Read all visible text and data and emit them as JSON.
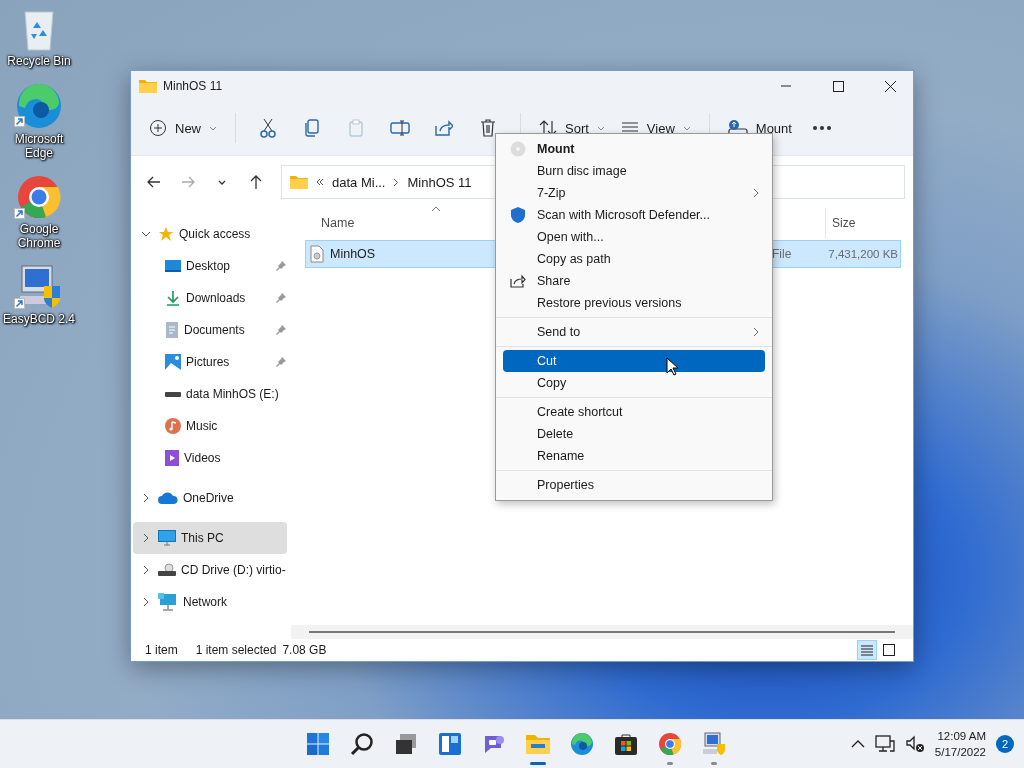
{
  "desktop_icons": [
    {
      "kind": "recycle",
      "label": "Recycle Bin",
      "shortcut": false
    },
    {
      "kind": "edge",
      "label": "Microsoft Edge",
      "shortcut": true
    },
    {
      "kind": "chrome",
      "label": "Google Chrome",
      "shortcut": true
    },
    {
      "kind": "easybcd",
      "label": "EasyBCD 2.4",
      "shortcut": true
    }
  ],
  "window": {
    "title": "MinhOS 11",
    "toolbar": [
      {
        "kind": "new",
        "label": "New",
        "disabled": false
      },
      {
        "kind": "separator"
      },
      {
        "kind": "cut",
        "disabled": false
      },
      {
        "kind": "copy",
        "disabled": false
      },
      {
        "kind": "paste",
        "disabled": true
      },
      {
        "kind": "rename",
        "disabled": false
      },
      {
        "kind": "share",
        "disabled": false
      },
      {
        "kind": "delete",
        "disabled": false
      },
      {
        "kind": "separator"
      },
      {
        "kind": "sort",
        "label": "Sort",
        "disabled": false
      },
      {
        "kind": "view",
        "label": "View",
        "disabled": false
      },
      {
        "kind": "separator"
      },
      {
        "kind": "mount",
        "label": "Mount",
        "disabled": false
      },
      {
        "kind": "more",
        "disabled": false
      }
    ],
    "nav": [
      {
        "kind": "back",
        "disabled": false
      },
      {
        "kind": "forward",
        "disabled": true
      },
      {
        "kind": "recent",
        "disabled": false
      },
      {
        "kind": "up",
        "disabled": false
      }
    ],
    "address": {
      "path": [
        "data Mi...",
        "MinhOS 11"
      ]
    },
    "sidebar": {
      "items": [
        {
          "kind": "star",
          "label": "Quick access",
          "expanded": true,
          "selected": false,
          "children": [
            {
              "kind": "desktop",
              "label": "Desktop",
              "pinned": true
            },
            {
              "kind": "download",
              "label": "Downloads",
              "pinned": true
            },
            {
              "kind": "documents",
              "label": "Documents",
              "pinned": true
            },
            {
              "kind": "pictures",
              "label": "Pictures",
              "pinned": true
            },
            {
              "kind": "drive",
              "label": "data MinhOS (E:)",
              "pinned": false
            },
            {
              "kind": "music",
              "label": "Music",
              "pinned": false
            },
            {
              "kind": "videos",
              "label": "Videos",
              "pinned": false
            }
          ]
        },
        {
          "kind": "cloud",
          "label": "OneDrive",
          "expanded": false,
          "selected": false
        },
        {
          "kind": "pc",
          "label": "This PC",
          "expanded": false,
          "selected": true
        },
        {
          "kind": "cd",
          "label": "CD Drive (D:) virtio-",
          "expanded": false,
          "selected": false
        },
        {
          "kind": "network",
          "label": "Network",
          "expanded": false,
          "selected": false
        }
      ]
    },
    "table": {
      "columns": [
        "Name",
        "Size"
      ],
      "rows": [
        {
          "name": "MinhOS",
          "type": "File",
          "size": "7,431,200 KB",
          "selected": true
        }
      ]
    },
    "status_bar": {
      "count": "1 item",
      "selection": "1 item selected",
      "size": "7.08 GB",
      "views": [
        {
          "kind": "details",
          "selected": true
        },
        {
          "kind": "tiles",
          "selected": false
        }
      ]
    }
  },
  "context_menu": {
    "items": [
      {
        "kind": "disc",
        "label": "Mount",
        "bold": true,
        "submenu": false,
        "selected": false
      },
      {
        "kind": "item",
        "label": "Burn disc image",
        "bold": false,
        "submenu": false,
        "selected": false
      },
      {
        "kind": "item",
        "label": "7-Zip",
        "bold": false,
        "submenu": true,
        "selected": false
      },
      {
        "kind": "shield",
        "label": "Scan with Microsoft Defender...",
        "bold": false,
        "submenu": false,
        "selected": false
      },
      {
        "kind": "item",
        "label": "Open with...",
        "bold": false,
        "submenu": false,
        "selected": false
      },
      {
        "kind": "item",
        "label": "Copy as path",
        "bold": false,
        "submenu": false,
        "selected": false
      },
      {
        "kind": "share",
        "label": "Share",
        "bold": false,
        "submenu": false,
        "selected": false
      },
      {
        "kind": "item",
        "label": "Restore previous versions",
        "bold": false,
        "submenu": false,
        "selected": false
      },
      {
        "kind": "separator"
      },
      {
        "kind": "item",
        "label": "Send to",
        "bold": false,
        "submenu": true,
        "selected": false
      },
      {
        "kind": "separator"
      },
      {
        "kind": "item",
        "label": "Cut",
        "bold": false,
        "submenu": false,
        "selected": true
      },
      {
        "kind": "item",
        "label": "Copy",
        "bold": false,
        "submenu": false,
        "selected": false
      },
      {
        "kind": "separator"
      },
      {
        "kind": "item",
        "label": "Create shortcut",
        "bold": false,
        "submenu": false,
        "selected": false
      },
      {
        "kind": "item",
        "label": "Delete",
        "bold": false,
        "submenu": false,
        "selected": false
      },
      {
        "kind": "item",
        "label": "Rename",
        "bold": false,
        "submenu": false,
        "selected": false
      },
      {
        "kind": "separator"
      },
      {
        "kind": "item",
        "label": "Properties",
        "bold": false,
        "submenu": false,
        "selected": false
      }
    ]
  },
  "taskbar": {
    "apps": [
      {
        "kind": "start",
        "running": false,
        "active": false
      },
      {
        "kind": "search",
        "running": false,
        "active": false
      },
      {
        "kind": "taskview",
        "running": false,
        "active": false
      },
      {
        "kind": "widgets",
        "running": false,
        "active": false
      },
      {
        "kind": "chat",
        "running": false,
        "active": false
      },
      {
        "kind": "explorer",
        "running": true,
        "active": true
      },
      {
        "kind": "edge",
        "running": false,
        "active": false
      },
      {
        "kind": "store",
        "running": false,
        "active": false
      },
      {
        "kind": "chrome",
        "running": true,
        "active": false
      },
      {
        "kind": "easybcd",
        "running": true,
        "active": false
      }
    ],
    "time": "12:09 AM",
    "date": "5/17/2022",
    "notifications": "2"
  }
}
